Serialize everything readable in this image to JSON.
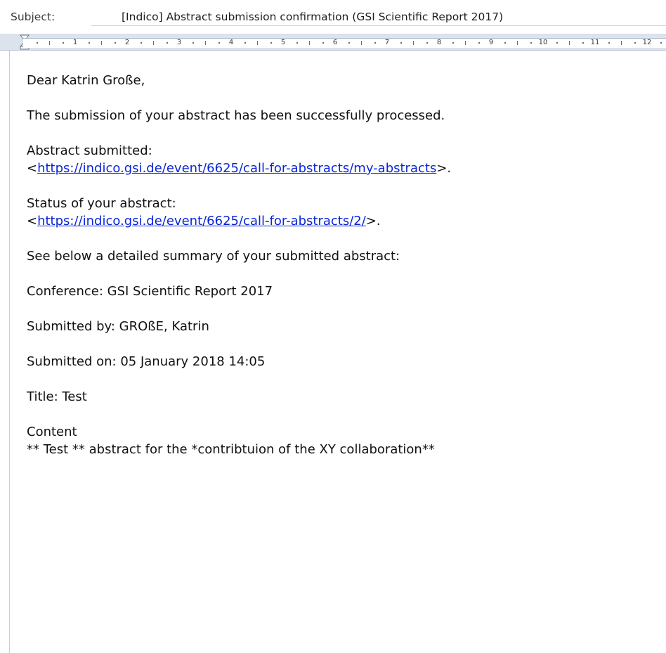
{
  "header": {
    "subject_label": "Subject:",
    "subject_value": "[Indico] Abstract submission confirmation (GSI Scientific Report 2017)"
  },
  "ruler": {
    "numbers": [
      "1",
      "2",
      "3",
      "4",
      "5",
      "6",
      "7",
      "8",
      "9",
      "10",
      "11",
      "12"
    ]
  },
  "email": {
    "greeting": "Dear Katrin Große,",
    "processed": "The submission of your abstract has been successfully processed.",
    "abstract_submitted_label": "Abstract submitted:",
    "abstract_link": "https://indico.gsi.de/event/6625/call-for-abstracts/my-abstracts",
    "status_label": "Status of your abstract:",
    "status_link": "https://indico.gsi.de/event/6625/call-for-abstracts/2/",
    "lt": "<",
    "gt_period": ">.",
    "summary_intro": "See below a detailed summary of your submitted abstract:",
    "conference": "Conference: GSI Scientific Report 2017",
    "submitted_by": "Submitted by: GROßE, Katrin",
    "submitted_on": "Submitted on: 05 January 2018 14:05",
    "title": "Title: Test",
    "content_label": "Content",
    "content_text": "** Test ** abstract for the *contribtuion of the XY collaboration**"
  }
}
